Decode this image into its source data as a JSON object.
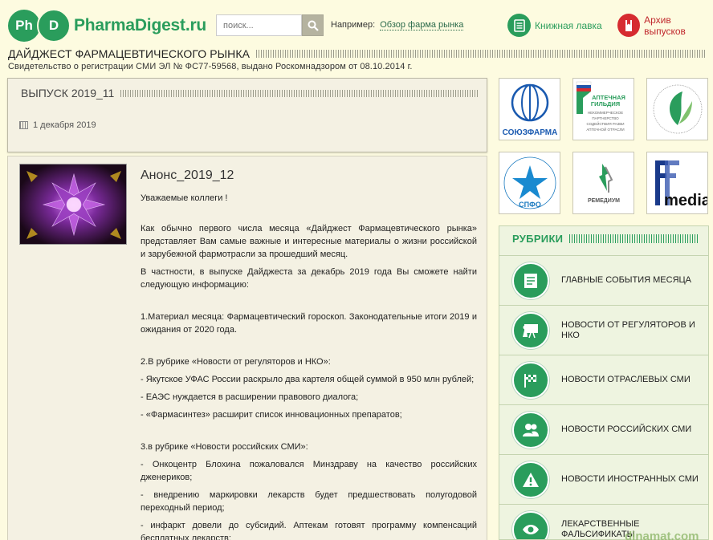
{
  "header": {
    "logo_mark_1": "Ph",
    "logo_mark_2": "D",
    "logo_text": "PharmaDigest.ru",
    "search_placeholder": "поиск...",
    "example_label": "Например:",
    "example_link": "Обзор фарма рынка",
    "books_label": "Книжная лавка",
    "archive_label": "Архив выпусков",
    "site_title": "ДАЙДЖЕСТ ФАРМАЦЕВТИЧЕСКОГО РЫНКА",
    "certificate": "Свидетельство о регистрации СМИ ЭЛ № ФС77-59568, выдано Роскомнадзором от 08.10.2014 г."
  },
  "issue": {
    "title": "ВЫПУСК 2019_11",
    "date": "1 декабря 2019"
  },
  "article": {
    "title": "Анонс_2019_12",
    "paragraphs": [
      "Уважаемые коллеги !",
      "Как обычно первого числа месяца «Дайджест Фармацевтического рынка» представляет Вам самые важные и интересные материалы о жизни российской и зарубежной фармотрасли за прошедший месяц.",
      "В частности, в выпуске Дайджеста за декабрь 2019 года Вы сможете найти следующую информацию:",
      "1.Материал месяца: Фармацевтический гороскоп. Законодательные итоги 2019 и ожидания от 2020 года.",
      "2.В рубрике «Новости от регуляторов и НКО»:",
      "- Якутское УФАС России раскрыло два картеля общей суммой в 950 млн рублей;",
      "- ЕАЭС нуждается в расширении правового диалога;",
      "- «Фармасинтез» расширит список инновационных препаратов;",
      "3.в рубрике «Новости российских СМИ»:",
      "- Онкоцентр Блохина пожаловался Минздраву на качество российских дженериков;",
      "- внедрению маркировки лекарств будет предшествовать полугодовой переходный период;",
      "- инфаркт довели до субсидий. Аптекам готовят программу компенсаций бесплатных лекарств;"
    ]
  },
  "partners": [
    {
      "name": "СОЮЗФАРМА",
      "icon": "soyuzfarma-logo"
    },
    {
      "name": "АПТЕЧНАЯ ГИЛЬДИЯ",
      "sub": "НЕКОММЕРЧЕСКОЕ ПАРТНЕРСТВО СОДЕЙСТВИЯ РАЗВИ АПТЕЧНОЙ ОТРАСЛИ",
      "icon": "guild-logo"
    },
    {
      "name": "",
      "icon": "leaf-association-logo"
    },
    {
      "name": "СПФО",
      "icon": "spfo-star-logo"
    },
    {
      "name": "РЕМЕДИУМ",
      "icon": "remedium-logo"
    },
    {
      "name": "media",
      "icon": "fmedia-logo"
    }
  ],
  "rubrics": {
    "title": "РУБРИКИ",
    "items": [
      {
        "label": "ГЛАВНЫЕ СОБЫТИЯ МЕСЯЦА",
        "icon": "document-icon"
      },
      {
        "label": "НОВОСТИ ОТ РЕГУЛЯТОРОВ И НКО",
        "icon": "presentation-icon"
      },
      {
        "label": "НОВОСТИ ОТРАСЛЕВЫХ СМИ",
        "icon": "flag-icon"
      },
      {
        "label": "НОВОСТИ РОССИЙСКИХ СМИ",
        "icon": "people-icon"
      },
      {
        "label": "НОВОСТИ ИНОСТРАННЫХ СМИ",
        "icon": "warning-icon"
      },
      {
        "label": "ЛЕКАРСТВЕННЫЕ ФАЛЬСИФИКАТЫ",
        "icon": "eye-icon"
      }
    ]
  },
  "watermark": "dinamat.com",
  "colors": {
    "brand_green": "#2a9d5c",
    "archive_red": "#d62b30",
    "background": "#fdfbe0"
  }
}
